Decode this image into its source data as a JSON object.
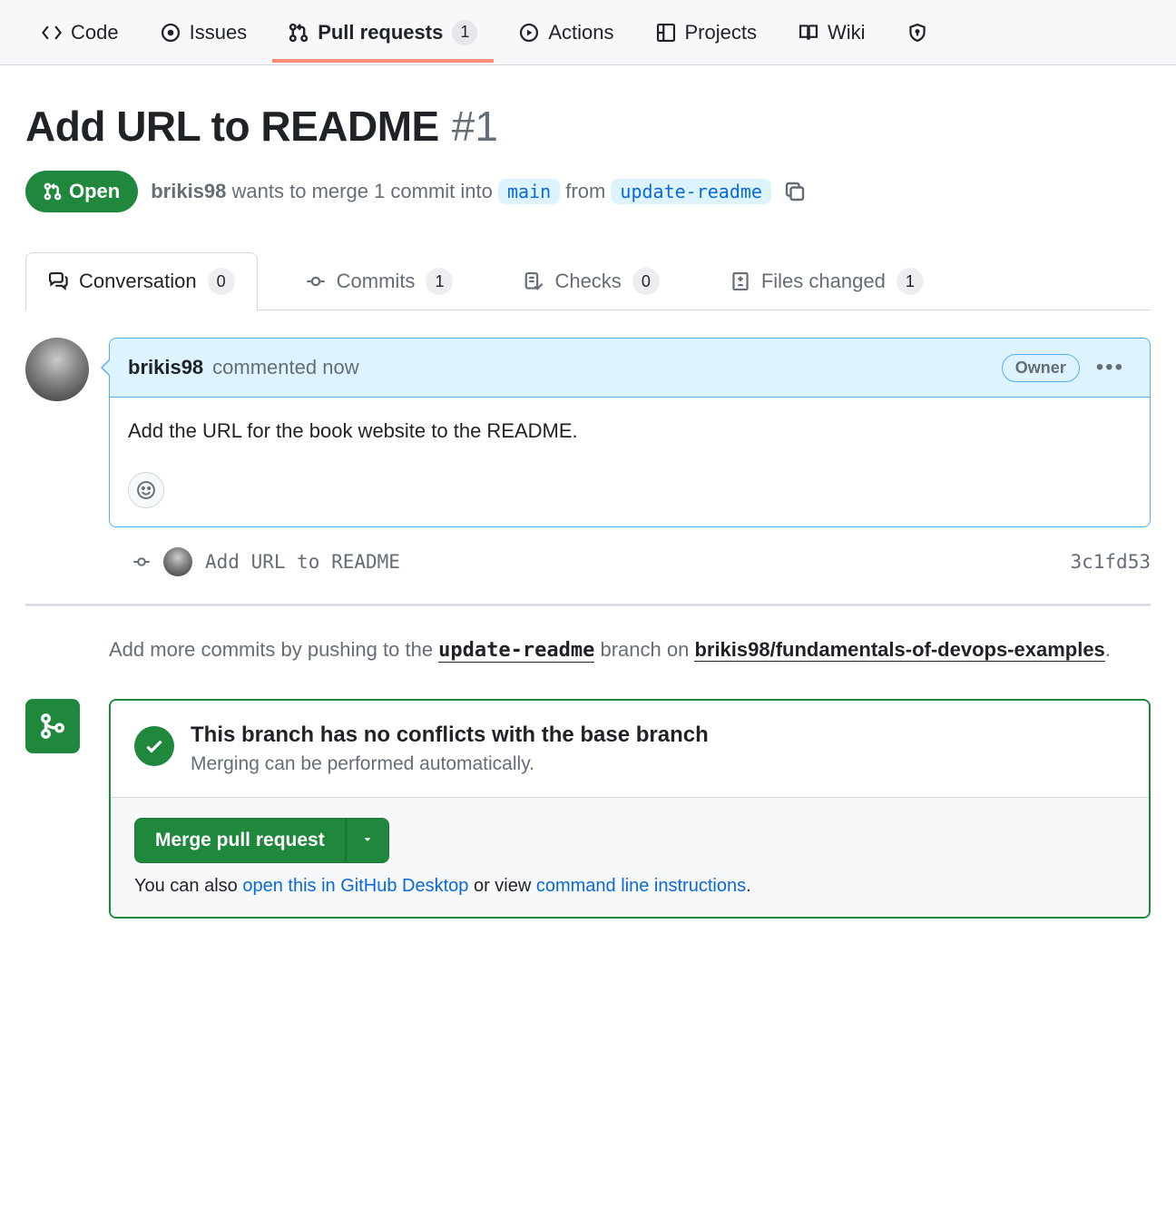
{
  "nav": {
    "code": "Code",
    "issues": "Issues",
    "pull_requests": "Pull requests",
    "pull_requests_count": "1",
    "actions": "Actions",
    "projects": "Projects",
    "wiki": "Wiki"
  },
  "pr": {
    "title": "Add URL to README",
    "number": "#1",
    "state": "Open",
    "author": "brikis98",
    "merge_verb": "wants to merge 1 commit into",
    "base_branch": "main",
    "from_word": "from",
    "head_branch": "update-readme"
  },
  "subtabs": {
    "conversation": "Conversation",
    "conversation_count": "0",
    "commits": "Commits",
    "commits_count": "1",
    "checks": "Checks",
    "checks_count": "0",
    "files": "Files changed",
    "files_count": "1"
  },
  "comment": {
    "author": "brikis98",
    "time": "commented now",
    "badge": "Owner",
    "body": "Add the URL for the book website to the README."
  },
  "commit": {
    "message": "Add URL to README",
    "sha": "3c1fd53"
  },
  "push_hint": {
    "prefix": "Add more commits by pushing to the ",
    "branch": "update-readme",
    "middle": " branch on ",
    "repo": "brikis98/fundamentals-of-devops-examples",
    "suffix": "."
  },
  "merge": {
    "status_title": "This branch has no conflicts with the base branch",
    "status_sub": "Merging can be performed automatically.",
    "button": "Merge pull request",
    "hint_prefix": "You can also ",
    "hint_link1": "open this in GitHub Desktop",
    "hint_middle": " or view ",
    "hint_link2": "command line instructions",
    "hint_suffix": "."
  }
}
